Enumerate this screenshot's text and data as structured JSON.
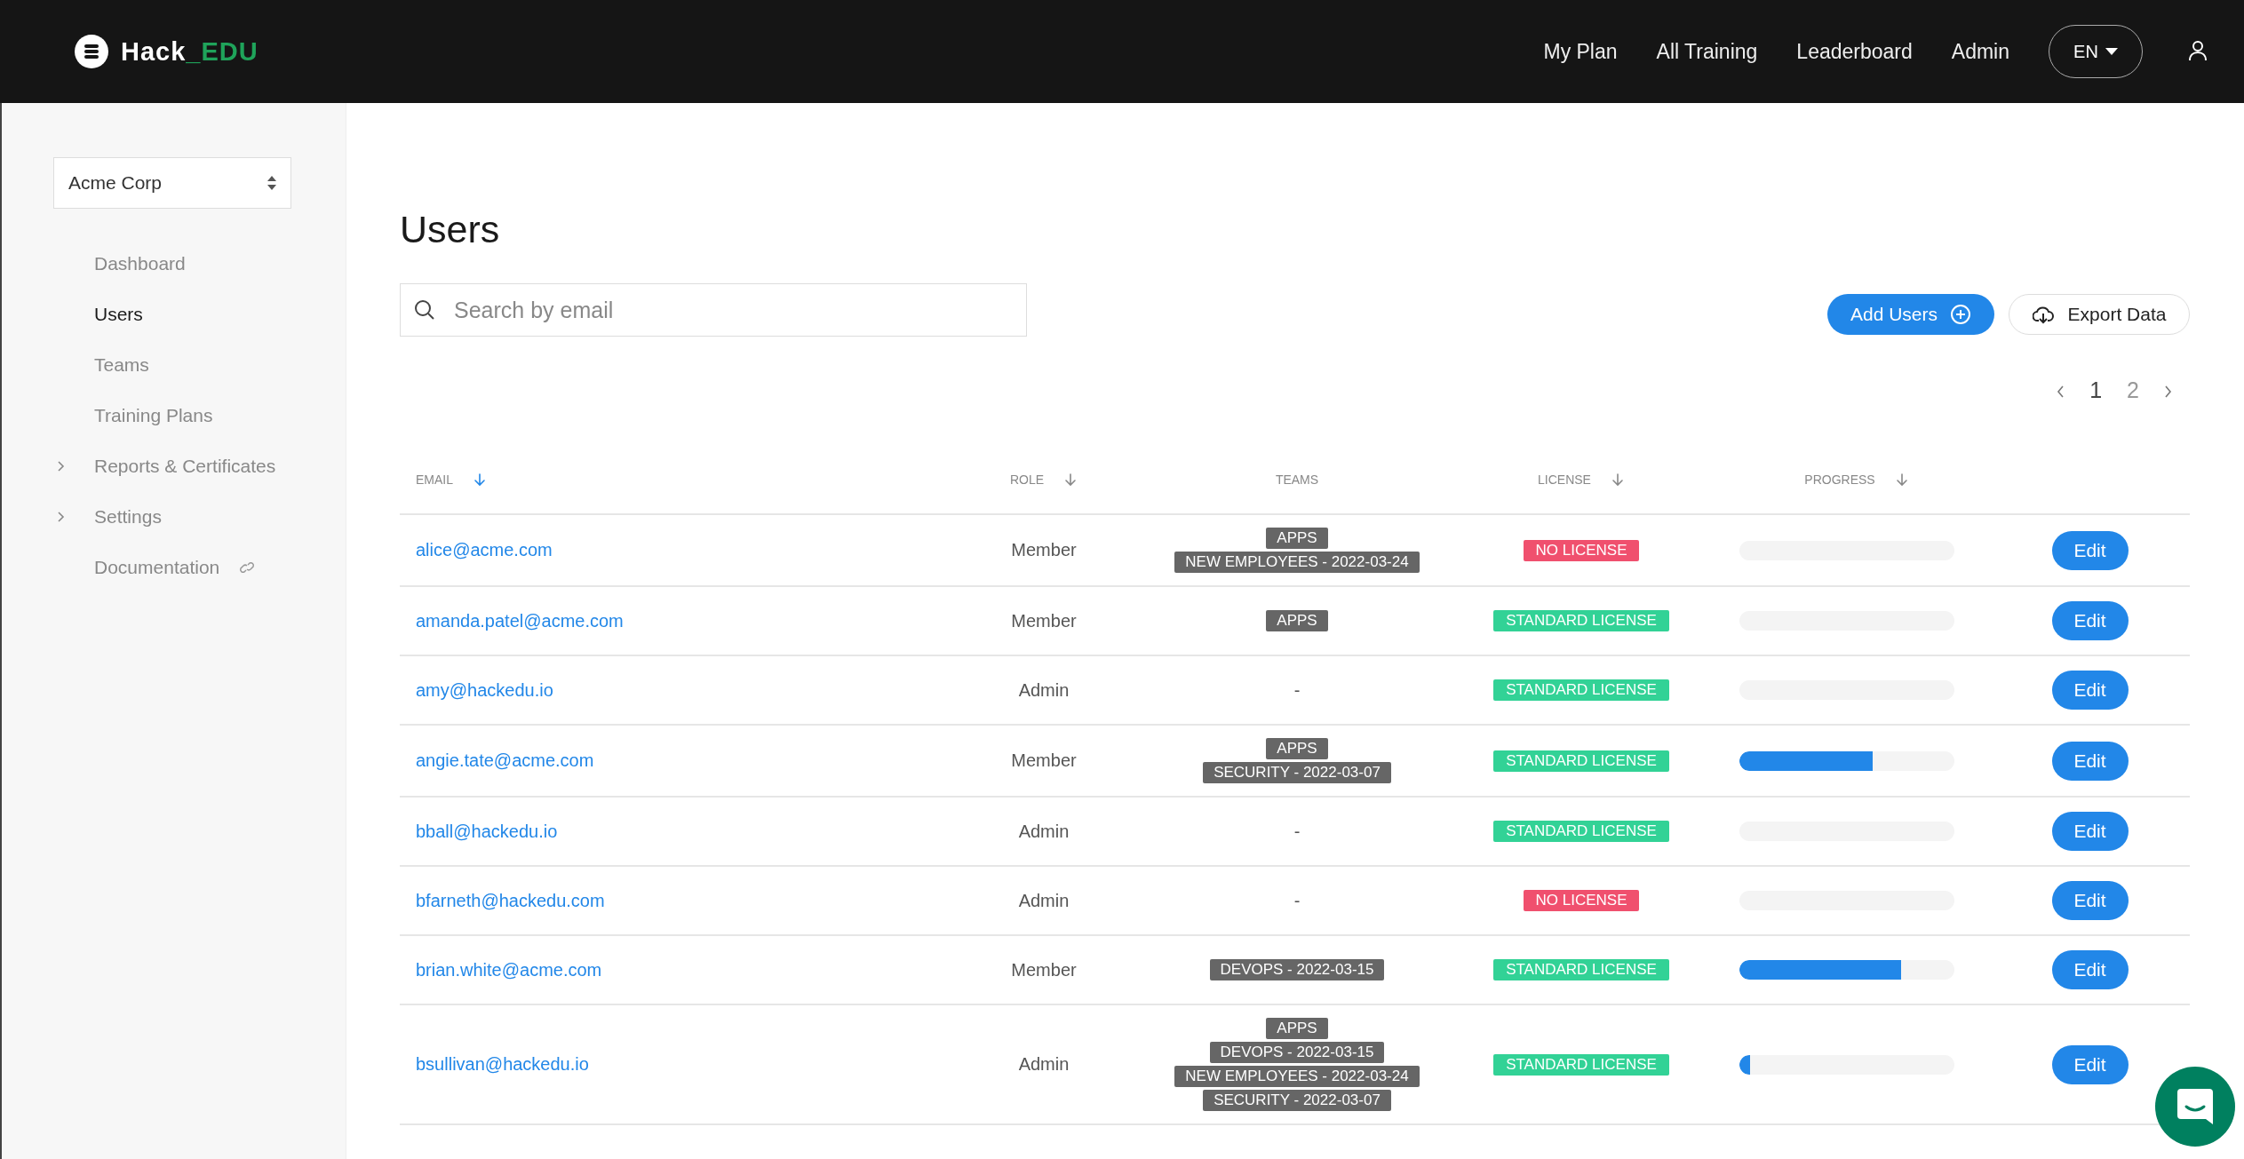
{
  "brand": {
    "name": "Hack",
    "accent": "_EDU"
  },
  "nav": [
    "My Plan",
    "All Training",
    "Leaderboard",
    "Admin"
  ],
  "language": "EN",
  "org_select": {
    "value": "Acme Corp"
  },
  "sidebar": {
    "items": [
      {
        "label": "Dashboard",
        "kind": "link",
        "selected": false
      },
      {
        "label": "Users",
        "kind": "link",
        "selected": true
      },
      {
        "label": "Teams",
        "kind": "link",
        "selected": false
      },
      {
        "label": "Training Plans",
        "kind": "link",
        "selected": false
      },
      {
        "label": "Reports & Certificates",
        "kind": "group",
        "selected": false
      },
      {
        "label": "Settings",
        "kind": "group",
        "selected": false
      },
      {
        "label": "Documentation",
        "kind": "external",
        "selected": false
      }
    ]
  },
  "page_title": "Users",
  "search": {
    "placeholder": "Search by email"
  },
  "actions": [
    {
      "label": "Add Users",
      "kind": "primary"
    },
    {
      "label": "Export Data",
      "kind": "secondary"
    }
  ],
  "pagination": [
    {
      "label": "1",
      "selected": true
    },
    {
      "label": "2",
      "selected": false
    }
  ],
  "table": {
    "columns": [
      {
        "label": "EMAIL",
        "sorted": true
      },
      {
        "label": "ROLE",
        "sorted": false
      },
      {
        "label": "TEAMS"
      },
      {
        "label": "LICENSE",
        "sorted": false
      },
      {
        "label": "PROGRESS",
        "sorted": false
      },
      {}
    ],
    "rows": [
      {
        "email": "alice@acme.com",
        "role": "Member",
        "teams": [
          "APPS",
          "NEW EMPLOYEES - 2022-03-24"
        ],
        "license": {
          "label": "NO LICENSE",
          "kind": "none"
        },
        "level": 0,
        "action": "Edit"
      },
      {
        "email": "amanda.patel@acme.com",
        "role": "Member",
        "teams": [
          "APPS"
        ],
        "license": {
          "label": "STANDARD LICENSE",
          "kind": "standard"
        },
        "level": 0,
        "action": "Edit"
      },
      {
        "email": "amy@hackedu.io",
        "role": "Admin",
        "teams_empty": "-",
        "license": {
          "label": "STANDARD LICENSE",
          "kind": "standard"
        },
        "level": 0,
        "action": "Edit"
      },
      {
        "email": "angie.tate@acme.com",
        "role": "Member",
        "teams": [
          "APPS",
          "SECURITY - 2022-03-07"
        ],
        "license": {
          "label": "STANDARD LICENSE",
          "kind": "standard"
        },
        "level": 0.62,
        "action": "Edit"
      },
      {
        "email": "bball@hackedu.io",
        "role": "Admin",
        "teams_empty": "-",
        "license": {
          "label": "STANDARD LICENSE",
          "kind": "standard"
        },
        "level": 0,
        "action": "Edit"
      },
      {
        "email": "bfarneth@hackedu.com",
        "role": "Admin",
        "teams_empty": "-",
        "license": {
          "label": "NO LICENSE",
          "kind": "none"
        },
        "level": 0,
        "action": "Edit"
      },
      {
        "email": "brian.white@acme.com",
        "role": "Member",
        "teams": [
          "DEVOPS - 2022-03-15"
        ],
        "license": {
          "label": "STANDARD LICENSE",
          "kind": "standard"
        },
        "level": 0.75,
        "action": "Edit"
      },
      {
        "email": "bsullivan@hackedu.io",
        "role": "Admin",
        "teams": [
          "APPS",
          "DEVOPS - 2022-03-15",
          "NEW EMPLOYEES - 2022-03-24",
          "SECURITY - 2022-03-07"
        ],
        "license": {
          "label": "STANDARD LICENSE",
          "kind": "standard"
        },
        "level": 0.05,
        "action": "Edit"
      }
    ]
  }
}
